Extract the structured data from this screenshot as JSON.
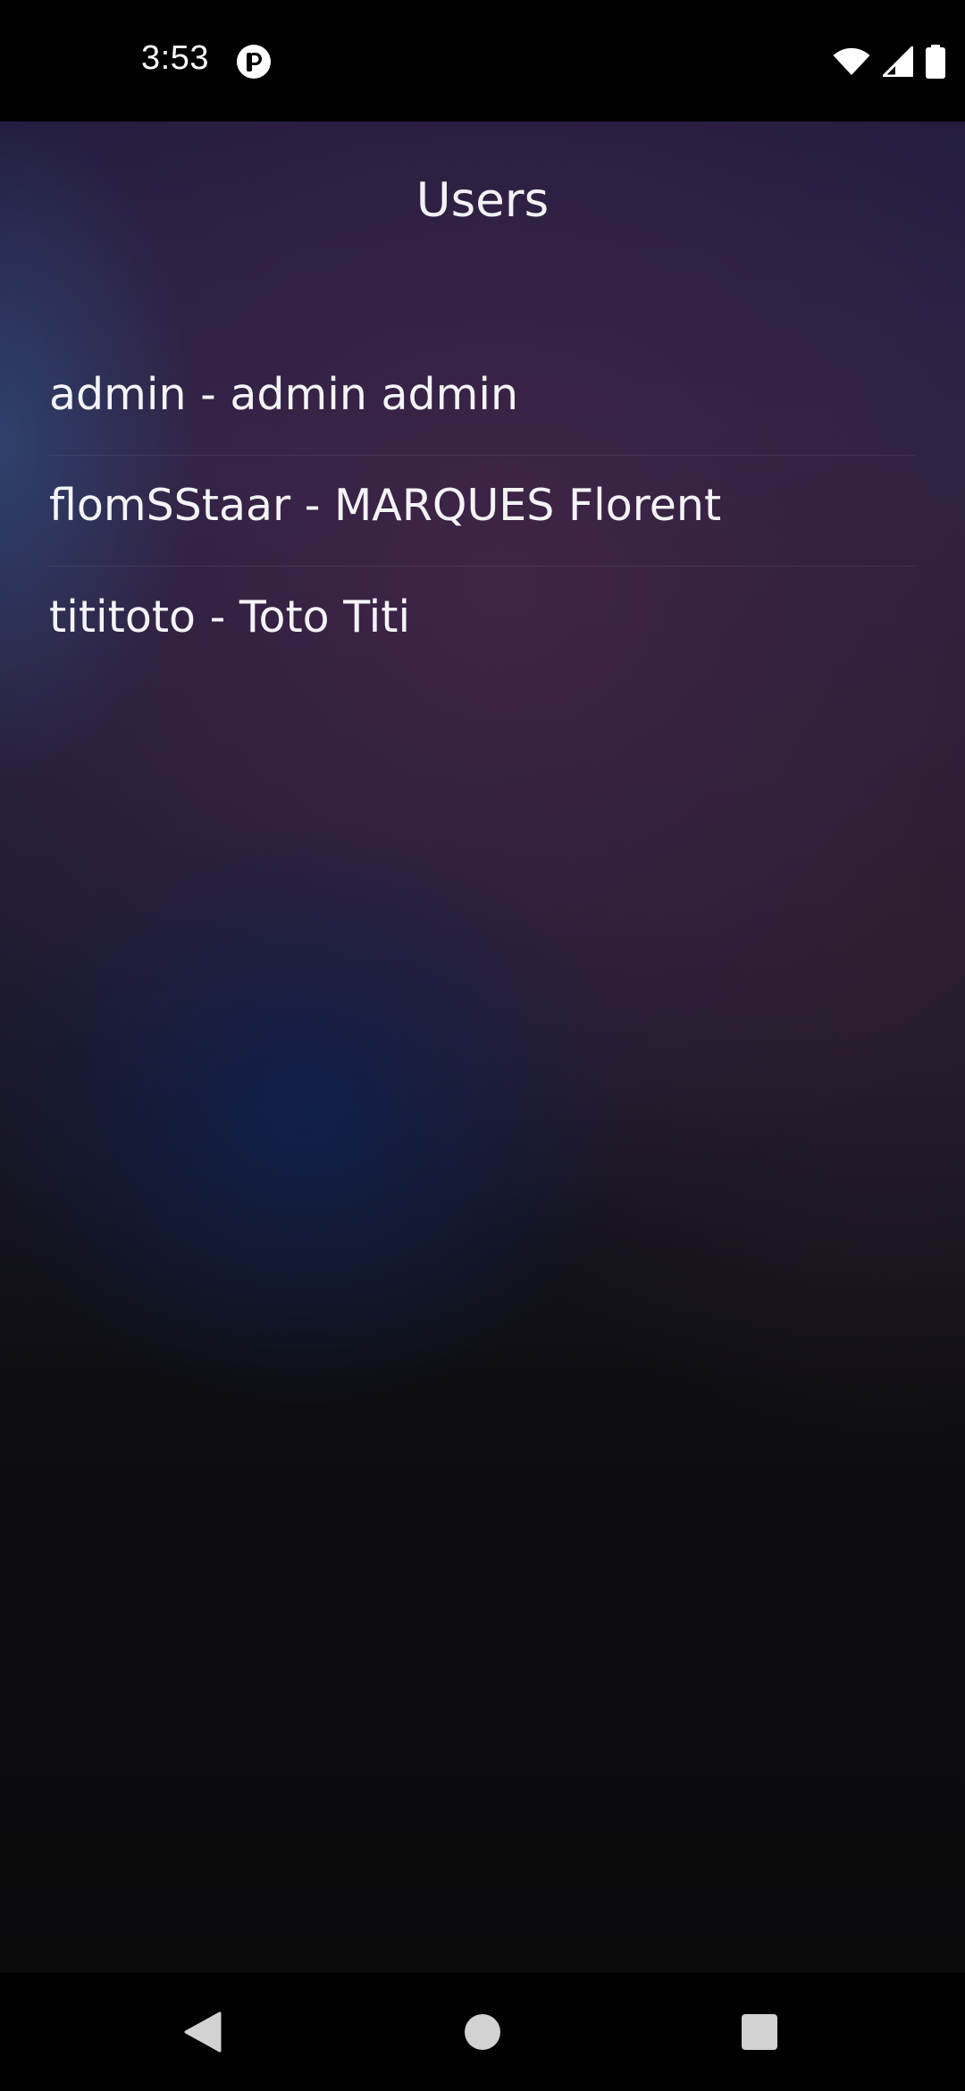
{
  "status_bar": {
    "time": "3:53",
    "app_icon": "app-notification-icon",
    "icons": [
      "wifi-icon",
      "signal-icon",
      "battery-icon"
    ]
  },
  "header": {
    "title": "Users"
  },
  "users": [
    {
      "label": "admin - admin admin"
    },
    {
      "label": "flomSStaar - MARQUES Florent"
    },
    {
      "label": "tititoto - Toto Titi"
    }
  ],
  "nav_bar": {
    "buttons": [
      "back-icon",
      "home-icon",
      "recents-icon"
    ]
  },
  "colors": {
    "text": "#f2f2f5",
    "background_dark": "#0a0a0b",
    "gradient_purple": "#402446",
    "gradient_blue": "#10204c"
  }
}
